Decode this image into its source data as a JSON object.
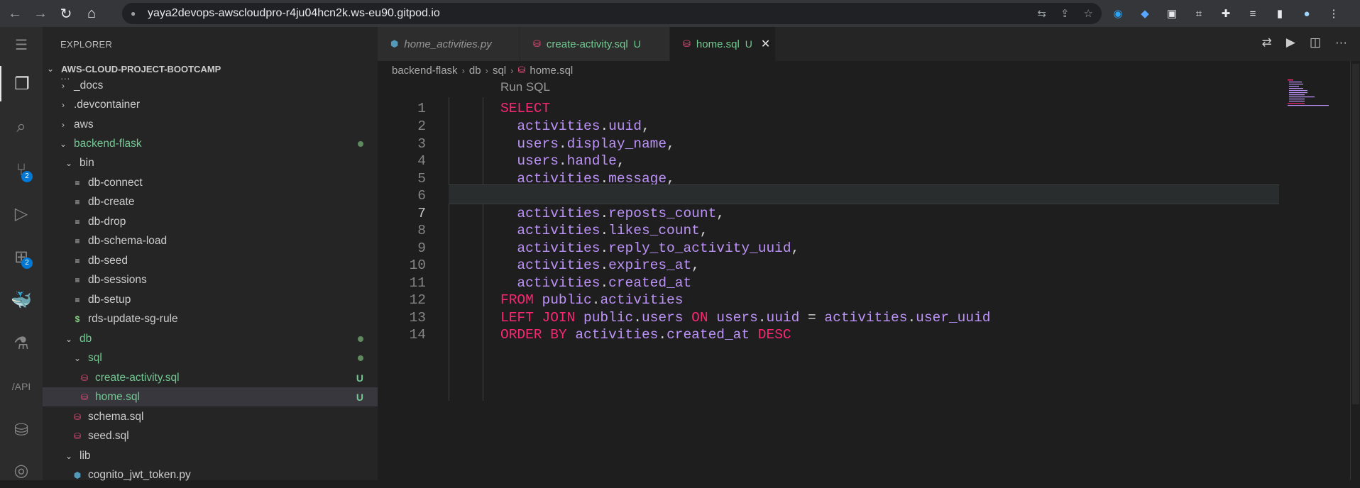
{
  "browser": {
    "url": "yaya2devops-awscloudpro-r4ju04hcn2k.ws-eu90.gitpod.io"
  },
  "activity_bar": {
    "scm_badge": "2",
    "extensions_badge": "2"
  },
  "explorer": {
    "title": "EXPLORER",
    "root": "AWS-CLOUD-PROJECT-BOOTCAMP",
    "items": [
      {
        "label": "_docs"
      },
      {
        "label": ".devcontainer"
      },
      {
        "label": "aws"
      },
      {
        "label": "backend-flask"
      },
      {
        "label": "bin"
      },
      {
        "label": "db-connect"
      },
      {
        "label": "db-create"
      },
      {
        "label": "db-drop"
      },
      {
        "label": "db-schema-load"
      },
      {
        "label": "db-seed"
      },
      {
        "label": "db-sessions"
      },
      {
        "label": "db-setup"
      },
      {
        "label": "rds-update-sg-rule"
      },
      {
        "label": "db"
      },
      {
        "label": "sql"
      },
      {
        "label": "create-activity.sql",
        "status": "U"
      },
      {
        "label": "home.sql",
        "status": "U"
      },
      {
        "label": "schema.sql"
      },
      {
        "label": "seed.sql"
      },
      {
        "label": "lib"
      },
      {
        "label": "cognito_jwt_token.py"
      }
    ]
  },
  "tabs": [
    {
      "label": "home_activities.py"
    },
    {
      "label": "create-activity.sql",
      "status": "U"
    },
    {
      "label": "home.sql",
      "status": "U"
    }
  ],
  "breadcrumb": [
    "backend-flask",
    "db",
    "sql",
    "home.sql"
  ],
  "editor": {
    "codelens": "Run SQL",
    "line_numbers": [
      "1",
      "2",
      "3",
      "4",
      "5",
      "6",
      "7",
      "8",
      "9",
      "10",
      "11",
      "12",
      "13",
      "14"
    ],
    "current_line": 7
  },
  "colors": {
    "keyword": "#f92672",
    "identifier": "#bd93f9",
    "untracked": "#73c991"
  }
}
